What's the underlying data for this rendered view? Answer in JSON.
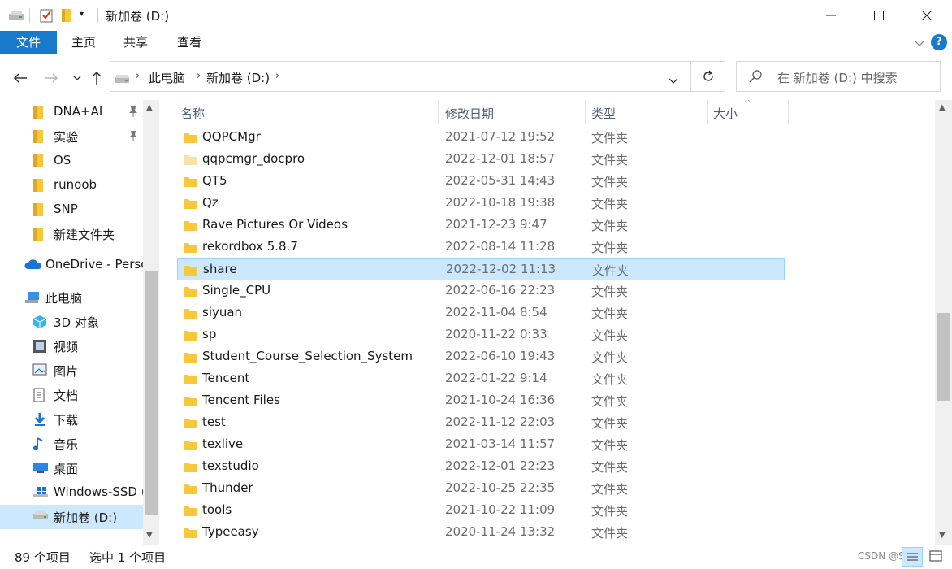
{
  "window": {
    "title": "新加卷 (D:)"
  },
  "ribbon": {
    "tabs": [
      "文件",
      "主页",
      "共享",
      "查看"
    ]
  },
  "address": {
    "segments": [
      "此电脑",
      "新加卷 (D:)"
    ]
  },
  "search": {
    "placeholder": "在 新加卷 (D:) 中搜索"
  },
  "sidebar": {
    "items": [
      {
        "label": "DNA+AI",
        "icon": "folder-icon",
        "pinned": true
      },
      {
        "label": "实验",
        "icon": "folder-icon",
        "pinned": true
      },
      {
        "label": "OS",
        "icon": "folder-icon",
        "pinned": false
      },
      {
        "label": "runoob",
        "icon": "folder-icon",
        "pinned": false
      },
      {
        "label": "SNP",
        "icon": "folder-icon",
        "pinned": false
      },
      {
        "label": "新建文件夹",
        "icon": "folder-icon",
        "pinned": false
      },
      {
        "label": "OneDrive - Perso",
        "icon": "onedrive-icon",
        "pinned": false
      },
      {
        "label": "此电脑",
        "icon": "computer-icon",
        "pinned": false
      },
      {
        "label": "3D 对象",
        "icon": "3d-objects-icon",
        "pinned": false
      },
      {
        "label": "视频",
        "icon": "video-icon",
        "pinned": false
      },
      {
        "label": "图片",
        "icon": "picture-icon",
        "pinned": false
      },
      {
        "label": "文档",
        "icon": "document-icon",
        "pinned": false
      },
      {
        "label": "下载",
        "icon": "download-icon",
        "pinned": false
      },
      {
        "label": "音乐",
        "icon": "music-icon",
        "pinned": false
      },
      {
        "label": "桌面",
        "icon": "desktop-icon",
        "pinned": false
      },
      {
        "label": "Windows-SSD (",
        "icon": "windows-drive-icon",
        "pinned": false
      },
      {
        "label": "新加卷 (D:)",
        "icon": "drive-icon",
        "pinned": false
      }
    ]
  },
  "columns": {
    "name": "名称",
    "date": "修改日期",
    "type": "类型",
    "size": "大小"
  },
  "files": [
    {
      "name": "QQPCMgr",
      "date": "2021-07-12 19:52",
      "type": "文件夹"
    },
    {
      "name": "qqpcmgr_docpro",
      "date": "2022-12-01 18:57",
      "type": "文件夹"
    },
    {
      "name": "QT5",
      "date": "2022-05-31 14:43",
      "type": "文件夹"
    },
    {
      "name": "Qz",
      "date": "2022-10-18 19:38",
      "type": "文件夹"
    },
    {
      "name": "Rave Pictures Or Videos",
      "date": "2021-12-23 9:47",
      "type": "文件夹"
    },
    {
      "name": "rekordbox 5.8.7",
      "date": "2022-08-14 11:28",
      "type": "文件夹"
    },
    {
      "name": "share",
      "date": "2022-12-02 11:13",
      "type": "文件夹",
      "selected": true
    },
    {
      "name": "Single_CPU",
      "date": "2022-06-16 22:23",
      "type": "文件夹"
    },
    {
      "name": "siyuan",
      "date": "2022-11-04 8:54",
      "type": "文件夹"
    },
    {
      "name": "sp",
      "date": "2020-11-22 0:33",
      "type": "文件夹"
    },
    {
      "name": "Student_Course_Selection_System",
      "date": "2022-06-10 19:43",
      "type": "文件夹"
    },
    {
      "name": "Tencent",
      "date": "2022-01-22 9:14",
      "type": "文件夹"
    },
    {
      "name": "Tencent Files",
      "date": "2021-10-24 16:36",
      "type": "文件夹"
    },
    {
      "name": "test",
      "date": "2022-11-12 22:03",
      "type": "文件夹"
    },
    {
      "name": "texlive",
      "date": "2021-03-14 11:57",
      "type": "文件夹"
    },
    {
      "name": "texstudio",
      "date": "2022-12-01 22:23",
      "type": "文件夹"
    },
    {
      "name": "Thunder",
      "date": "2022-10-25 22:35",
      "type": "文件夹"
    },
    {
      "name": "tools",
      "date": "2021-10-22 11:09",
      "type": "文件夹"
    },
    {
      "name": "Typeeasy",
      "date": "2020-11-24 13:32",
      "type": "文件夹"
    }
  ],
  "status": {
    "count": "89 个项目",
    "selection": "选中 1 个项目"
  },
  "watermark": "CSDN @Sh",
  "colors": {
    "accent": "#1979ca",
    "selection": "#cce8ff",
    "folder": "#f8c83c"
  }
}
